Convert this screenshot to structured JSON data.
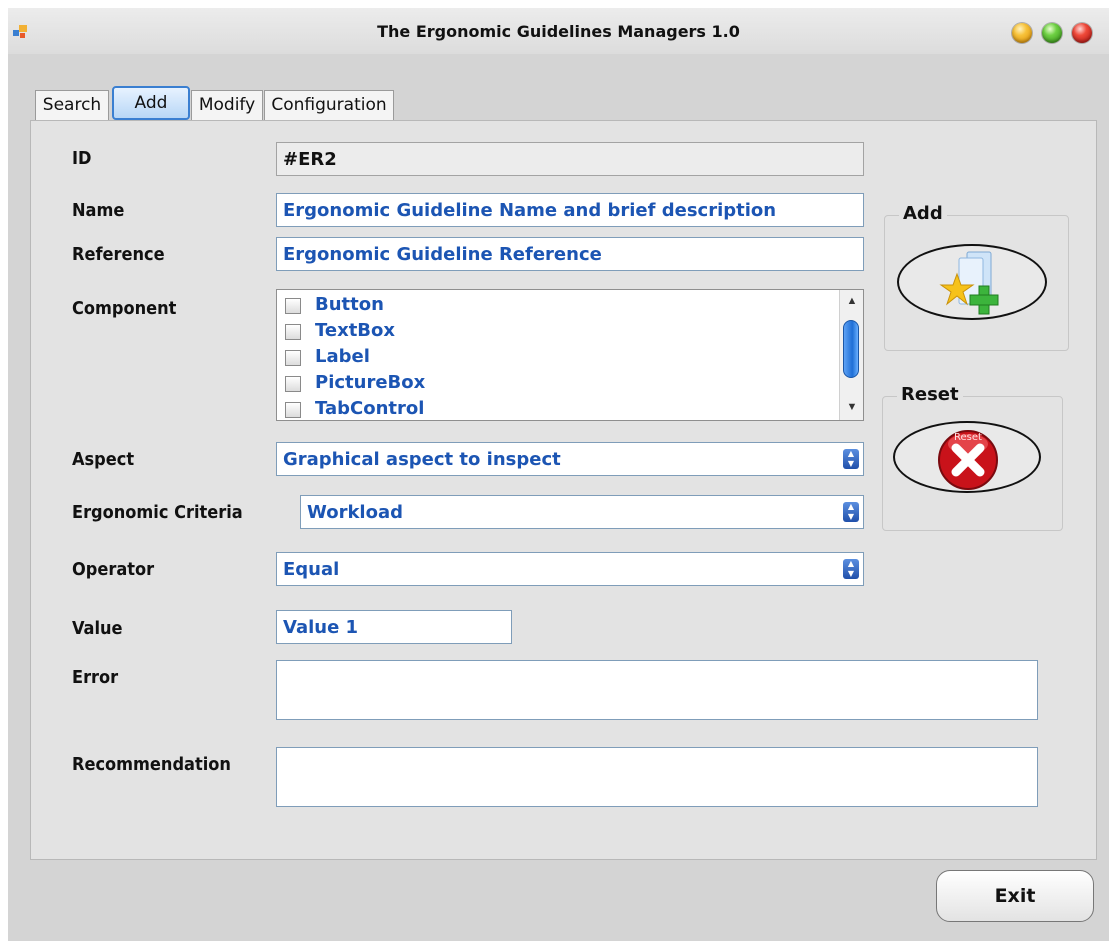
{
  "window": {
    "title": "The Ergonomic Guidelines Managers 1.0",
    "buttons": [
      "minimize",
      "maximize",
      "close"
    ]
  },
  "tabs": [
    {
      "label": "Search",
      "active": false
    },
    {
      "label": "Add",
      "active": true
    },
    {
      "label": "Modify",
      "active": false
    },
    {
      "label": "Configuration",
      "active": false
    }
  ],
  "form": {
    "id": {
      "label": "ID",
      "value": "#ER2"
    },
    "name": {
      "label": "Name",
      "value": "Ergonomic Guideline Name and brief description"
    },
    "reference": {
      "label": "Reference",
      "value": "Ergonomic Guideline Reference"
    },
    "component": {
      "label": "Component",
      "options": [
        "Button",
        "TextBox",
        "Label",
        "PictureBox",
        "TabControl"
      ]
    },
    "aspect": {
      "label": "Aspect",
      "value": "Graphical aspect to inspect"
    },
    "criteria": {
      "label": "Ergonomic Criteria",
      "value": "Workload"
    },
    "operator": {
      "label": "Operator",
      "value": "Equal"
    },
    "value": {
      "label": "Value",
      "value": "Value 1"
    },
    "error": {
      "label": "Error",
      "value": ""
    },
    "recommendation": {
      "label": "Recommendation",
      "value": ""
    }
  },
  "actions": {
    "add_group": "Add",
    "reset_group": "Reset",
    "reset_badge": "Reset",
    "exit": "Exit"
  },
  "colors": {
    "input_text": "#1c55b3",
    "window_bg": "#d4d4d4",
    "panel_bg": "#e3e3e3",
    "tab_active": "#3a7fd1"
  },
  "icons": {
    "add": "folder-star-plus-icon",
    "reset": "red-x-circle-icon"
  }
}
